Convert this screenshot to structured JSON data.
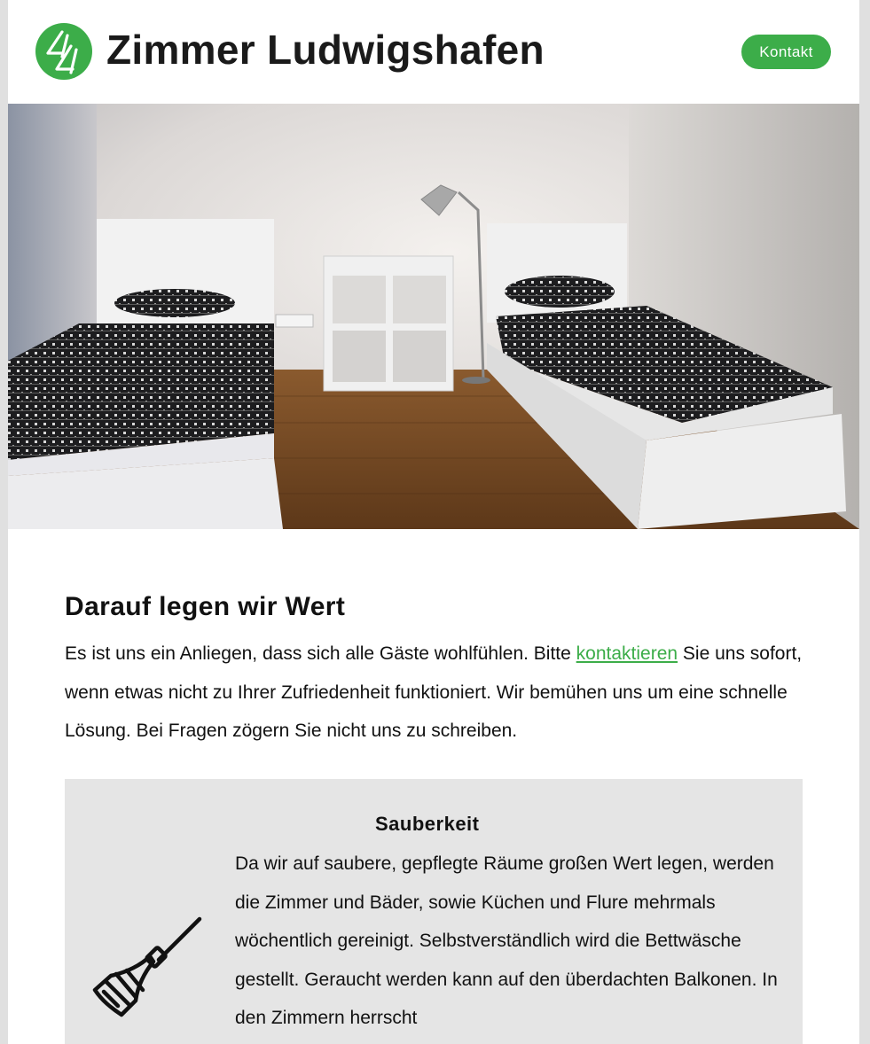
{
  "header": {
    "title": "Zimmer Ludwigshafen",
    "contact_label": "Kontakt",
    "brand_color": "#3cad49"
  },
  "hero": {
    "image": "room-photo"
  },
  "values_section": {
    "title": "Darauf legen wir Wert",
    "intro_before": "Es ist uns ein Anliegen, dass sich alle Gäste wohlfühlen. Bitte ",
    "intro_link": "kontaktieren",
    "intro_after": " Sie uns sofort, wenn etwas nicht zu Ihrer Zufriedenheit funktioniert. Wir bemühen uns um eine schnelle Lösung. Bei Fragen zögern Sie nicht uns zu schreiben."
  },
  "cards": [
    {
      "title": "Sauberkeit",
      "icon": "broom-icon",
      "text": "Da wir auf saubere, gepflegte Räume großen Wert legen, werden die Zimmer und Bäder, sowie Küchen und Flure mehrmals wöchentlich gereinigt. Selbstverständlich wird die Bettwäsche gestellt. Geraucht werden kann auf den überdachten Balkonen. In den Zimmern herrscht"
    }
  ]
}
